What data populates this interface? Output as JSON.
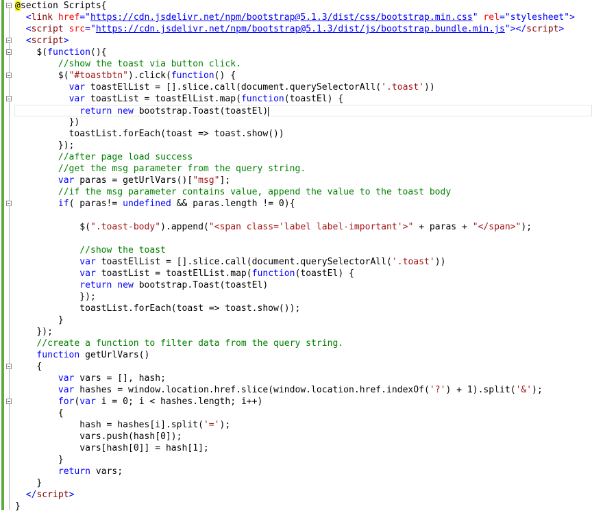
{
  "accent_colors": {
    "change_bar": "#5cab3f",
    "keyword": "#0000ff",
    "comment": "#008000",
    "string": "#a31515",
    "razor_highlight": "#ffff00"
  },
  "lines": [
    {
      "indent": "",
      "tokens": [
        [
          "razor",
          "@"
        ],
        [
          "n",
          "section Scripts{"
        ]
      ]
    },
    {
      "indent": "  ",
      "tokens": [
        [
          "tagbr",
          "<"
        ],
        [
          "tag",
          "link"
        ],
        [
          "n",
          " "
        ],
        [
          "attr",
          "href"
        ],
        [
          "tagbr",
          "="
        ],
        [
          "tagbr",
          "\""
        ],
        [
          "url",
          "https://cdn.jsdelivr.net/npm/bootstrap@5.1.3/dist/css/bootstrap.min.css"
        ],
        [
          "tagbr",
          "\""
        ],
        [
          "n",
          " "
        ],
        [
          "attr",
          "rel"
        ],
        [
          "tagbr",
          "="
        ],
        [
          "tagbr",
          "\"stylesheet\">"
        ]
      ]
    },
    {
      "indent": "  ",
      "tokens": [
        [
          "tagbr",
          "<"
        ],
        [
          "tag",
          "script"
        ],
        [
          "n",
          " "
        ],
        [
          "attr",
          "src"
        ],
        [
          "tagbr",
          "="
        ],
        [
          "tagbr",
          "\""
        ],
        [
          "url",
          "https://cdn.jsdelivr.net/npm/bootstrap@5.1.3/dist/js/bootstrap.bundle.min.js"
        ],
        [
          "tagbr",
          "\"></"
        ],
        [
          "tag",
          "script"
        ],
        [
          "tagbr",
          ">"
        ]
      ]
    },
    {
      "indent": "  ",
      "tokens": [
        [
          "tagbr",
          "<"
        ],
        [
          "tag",
          "script"
        ],
        [
          "tagbr",
          ">"
        ]
      ]
    },
    {
      "indent": "    ",
      "tokens": [
        [
          "n",
          "$("
        ],
        [
          "kw",
          "function"
        ],
        [
          "n",
          "(){"
        ]
      ]
    },
    {
      "indent": "        ",
      "tokens": [
        [
          "cm",
          "//show the toast via button click."
        ]
      ]
    },
    {
      "indent": "        ",
      "tokens": [
        [
          "n",
          "$("
        ],
        [
          "str",
          "\"#toastbtn\""
        ],
        [
          "n",
          ").click("
        ],
        [
          "kw",
          "function"
        ],
        [
          "n",
          "() {"
        ]
      ]
    },
    {
      "indent": "          ",
      "tokens": [
        [
          "kw",
          "var"
        ],
        [
          "n",
          " toastElList = [].slice.call(document.querySelectorAll("
        ],
        [
          "str",
          "'.toast'"
        ],
        [
          "n",
          "))"
        ]
      ]
    },
    {
      "indent": "          ",
      "tokens": [
        [
          "kw",
          "var"
        ],
        [
          "n",
          " toastList = toastElList.map("
        ],
        [
          "kw",
          "function"
        ],
        [
          "n",
          "(toastEl) {"
        ]
      ]
    },
    {
      "indent": "            ",
      "current": true,
      "tokens": [
        [
          "kw",
          "return"
        ],
        [
          "n",
          " "
        ],
        [
          "kw",
          "new"
        ],
        [
          "n",
          " bootstrap.Toast(toastEl)"
        ],
        [
          "caret",
          ""
        ]
      ]
    },
    {
      "indent": "          ",
      "tokens": [
        [
          "n",
          "})"
        ]
      ]
    },
    {
      "indent": "          ",
      "tokens": [
        [
          "n",
          "toastList.forEach(toast => toast.show())"
        ]
      ]
    },
    {
      "indent": "        ",
      "tokens": [
        [
          "n",
          "});"
        ]
      ]
    },
    {
      "indent": "        ",
      "tokens": [
        [
          "cm",
          "//after page load success"
        ]
      ]
    },
    {
      "indent": "        ",
      "tokens": [
        [
          "cm",
          "//get the msg parameter from the query string."
        ]
      ]
    },
    {
      "indent": "        ",
      "tokens": [
        [
          "kw",
          "var"
        ],
        [
          "n",
          " paras = getUrlVars()["
        ],
        [
          "str",
          "\"msg\""
        ],
        [
          "n",
          "];"
        ]
      ]
    },
    {
      "indent": "        ",
      "tokens": [
        [
          "cm",
          "//if the msg parameter contains value, append the value to the toast body"
        ]
      ]
    },
    {
      "indent": "        ",
      "tokens": [
        [
          "kw",
          "if"
        ],
        [
          "n",
          "( paras!= "
        ],
        [
          "kw",
          "undefined"
        ],
        [
          "n",
          " && paras.length != 0){"
        ]
      ]
    },
    {
      "indent": "",
      "tokens": []
    },
    {
      "indent": "            ",
      "tokens": [
        [
          "n",
          "$("
        ],
        [
          "str",
          "\".toast-body\""
        ],
        [
          "n",
          ").append("
        ],
        [
          "str",
          "\"<span class='label label-important'>\""
        ],
        [
          "n",
          " + paras + "
        ],
        [
          "str",
          "\"</span>\""
        ],
        [
          "n",
          ");"
        ]
      ]
    },
    {
      "indent": "",
      "tokens": []
    },
    {
      "indent": "            ",
      "tokens": [
        [
          "cm",
          "//show the toast"
        ]
      ]
    },
    {
      "indent": "            ",
      "tokens": [
        [
          "kw",
          "var"
        ],
        [
          "n",
          " toastElList = [].slice.call(document.querySelectorAll("
        ],
        [
          "str",
          "'.toast'"
        ],
        [
          "n",
          "))"
        ]
      ]
    },
    {
      "indent": "            ",
      "tokens": [
        [
          "kw",
          "var"
        ],
        [
          "n",
          " toastList = toastElList.map("
        ],
        [
          "kw",
          "function"
        ],
        [
          "n",
          "(toastEl) {"
        ]
      ]
    },
    {
      "indent": "            ",
      "tokens": [
        [
          "kw",
          "return"
        ],
        [
          "n",
          " "
        ],
        [
          "kw",
          "new"
        ],
        [
          "n",
          " bootstrap.Toast(toastEl)"
        ]
      ]
    },
    {
      "indent": "            ",
      "tokens": [
        [
          "n",
          "});"
        ]
      ]
    },
    {
      "indent": "            ",
      "tokens": [
        [
          "n",
          "toastList.forEach(toast => toast.show());"
        ]
      ]
    },
    {
      "indent": "        ",
      "tokens": [
        [
          "n",
          "}"
        ]
      ]
    },
    {
      "indent": "    ",
      "tokens": [
        [
          "n",
          "});"
        ]
      ]
    },
    {
      "indent": "    ",
      "tokens": [
        [
          "cm",
          "//create a function to filter data from the query string."
        ]
      ]
    },
    {
      "indent": "    ",
      "tokens": [
        [
          "kw",
          "function"
        ],
        [
          "n",
          " getUrlVars()"
        ]
      ]
    },
    {
      "indent": "    ",
      "tokens": [
        [
          "n",
          "{"
        ]
      ]
    },
    {
      "indent": "        ",
      "tokens": [
        [
          "kw",
          "var"
        ],
        [
          "n",
          " vars = [], hash;"
        ]
      ]
    },
    {
      "indent": "        ",
      "tokens": [
        [
          "kw",
          "var"
        ],
        [
          "n",
          " hashes = window.location.href.slice(window.location.href.indexOf("
        ],
        [
          "str",
          "'?'"
        ],
        [
          "n",
          ") + 1).split("
        ],
        [
          "str",
          "'&'"
        ],
        [
          "n",
          ");"
        ]
      ]
    },
    {
      "indent": "        ",
      "tokens": [
        [
          "kw",
          "for"
        ],
        [
          "n",
          "("
        ],
        [
          "kw",
          "var"
        ],
        [
          "n",
          " i = 0; i < hashes.length; i++)"
        ]
      ]
    },
    {
      "indent": "        ",
      "tokens": [
        [
          "n",
          "{"
        ]
      ]
    },
    {
      "indent": "            ",
      "tokens": [
        [
          "n",
          "hash = hashes[i].split("
        ],
        [
          "str",
          "'='"
        ],
        [
          "n",
          ");"
        ]
      ]
    },
    {
      "indent": "            ",
      "tokens": [
        [
          "n",
          "vars.push(hash[0]);"
        ]
      ]
    },
    {
      "indent": "            ",
      "tokens": [
        [
          "n",
          "vars[hash[0]] = hash[1];"
        ]
      ]
    },
    {
      "indent": "        ",
      "tokens": [
        [
          "n",
          "}"
        ]
      ]
    },
    {
      "indent": "        ",
      "tokens": [
        [
          "kw",
          "return"
        ],
        [
          "n",
          " vars;"
        ]
      ]
    },
    {
      "indent": "    ",
      "tokens": [
        [
          "n",
          "}"
        ]
      ]
    },
    {
      "indent": "  ",
      "tokens": [
        [
          "tagbr",
          "</"
        ],
        [
          "tag",
          "script"
        ],
        [
          "tagbr",
          ">"
        ]
      ]
    },
    {
      "indent": "",
      "tokens": [
        [
          "n",
          "}"
        ]
      ]
    }
  ]
}
